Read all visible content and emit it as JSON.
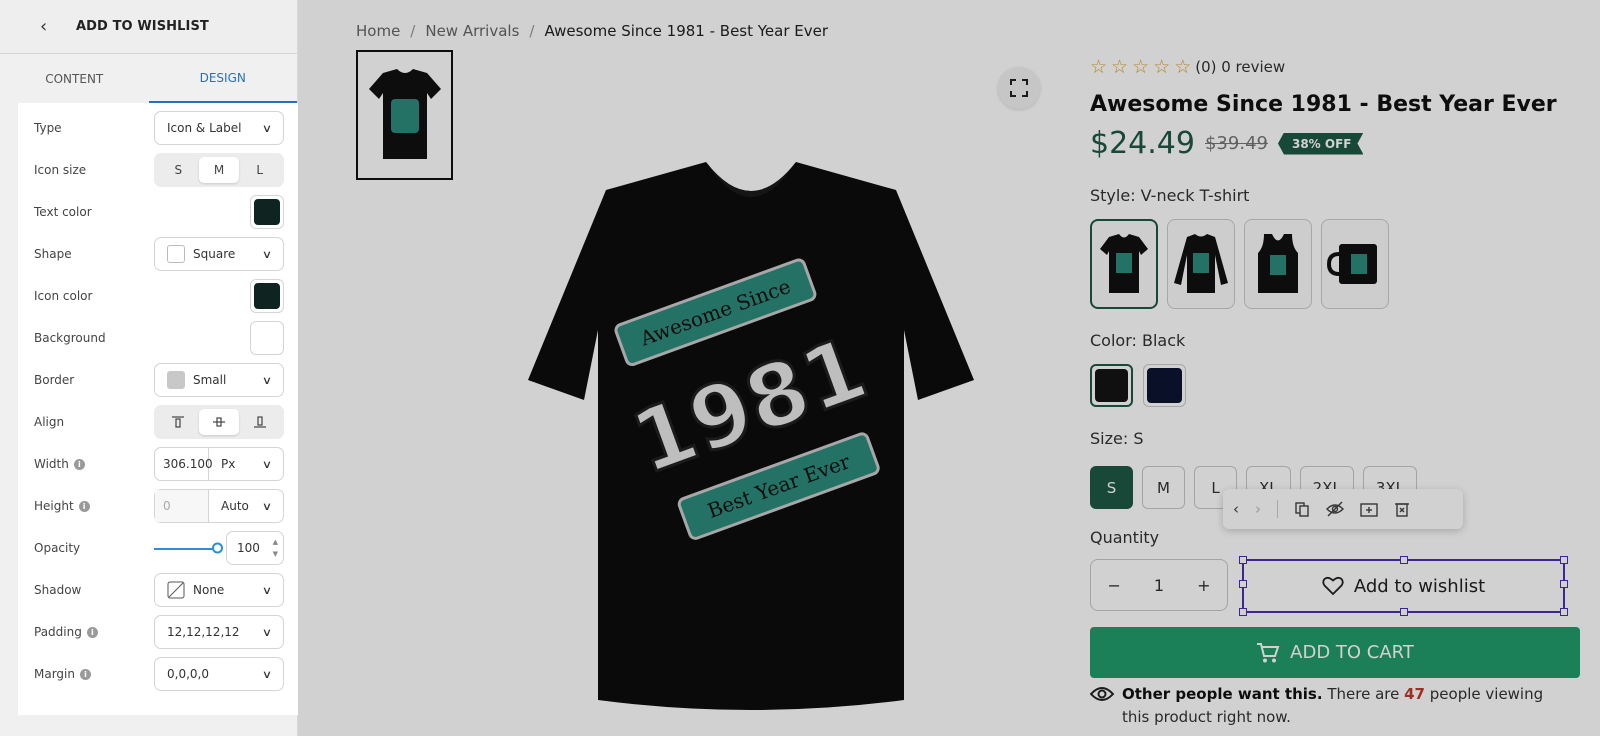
{
  "sidebar": {
    "title": "ADD TO WISHLIST",
    "tabs": [
      {
        "label": "CONTENT",
        "active": false
      },
      {
        "label": "DESIGN",
        "active": true
      }
    ],
    "rows": {
      "type": {
        "label": "Type",
        "value": "Icon & Label"
      },
      "icon_size": {
        "label": "Icon size",
        "options": [
          "S",
          "M",
          "L"
        ],
        "selected": "M"
      },
      "text_color": {
        "label": "Text color",
        "color": "#0f2420"
      },
      "shape": {
        "label": "Shape",
        "value": "Square"
      },
      "icon_color": {
        "label": "Icon color",
        "color": "#0f2420"
      },
      "background": {
        "label": "Background",
        "color": "#ffffff"
      },
      "border": {
        "label": "Border",
        "value": "Small",
        "color": "#c8c8c8"
      },
      "align": {
        "label": "Align",
        "options": [
          "top-align-icon",
          "center-align-icon",
          "bottom-align-icon"
        ],
        "selected": "center-align-icon"
      },
      "width": {
        "label": "Width",
        "value": "306.100",
        "unit": "Px"
      },
      "height": {
        "label": "Height",
        "value": "0",
        "unit": "Auto"
      },
      "opacity": {
        "label": "Opacity",
        "value": "100"
      },
      "shadow": {
        "label": "Shadow",
        "value": "None"
      },
      "padding": {
        "label": "Padding",
        "value": "12,12,12,12"
      },
      "margin": {
        "label": "Margin",
        "value": "0,0,0,0"
      }
    }
  },
  "breadcrumb": {
    "items": [
      "Home",
      "New Arrivals",
      "Awesome Since 1981 - Best Year Ever"
    ],
    "separator": "/"
  },
  "product": {
    "rating_text": "(0) 0 review",
    "title": "Awesome Since 1981 - Best Year Ever",
    "price": "$24.49",
    "compare_price": "$39.49",
    "discount": "38% OFF",
    "style_label": "Style: V-neck T-shirt",
    "styles": [
      "V-neck T-shirt",
      "Long sleeve",
      "Tank top",
      "Mug"
    ],
    "color_label": "Color: Black",
    "colors": [
      {
        "name": "Black",
        "hex": "#141414"
      },
      {
        "name": "Navy",
        "hex": "#0e1433"
      }
    ],
    "size_label": "Size: S",
    "sizes": [
      "S",
      "M",
      "L",
      "XL",
      "2XL",
      "3XL"
    ],
    "selected_size": "S",
    "quantity_label": "Quantity",
    "quantity": "1",
    "wishlist_label": "Add to wishlist",
    "cart_label": "ADD TO CART",
    "viewers_bold": "Other people want this.",
    "viewers_pre": "There are",
    "viewers_count": "47",
    "viewers_post": "people viewing this product right now.",
    "print": {
      "line1": "Awesome Since",
      "year": "1981",
      "line2": "Best Year Ever"
    }
  },
  "colors": {
    "accent_green": "#1e5a45",
    "cart_green": "#229b6c",
    "selection_purple": "#4b2fb0",
    "tab_blue": "#2a6fb6"
  }
}
